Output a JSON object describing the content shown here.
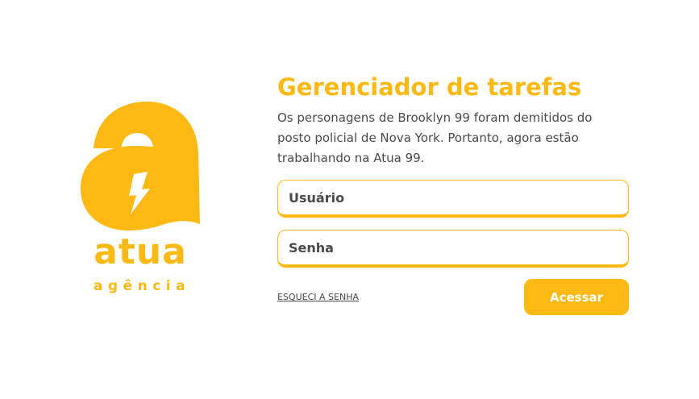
{
  "colors": {
    "brand_yellow": "#fdb913",
    "text_dark": "#4a4a4a",
    "background": "#ffffff"
  },
  "logo": {
    "mark_icon": "atua-a-lightning-logo-icon",
    "word": "atua",
    "sub": "agência"
  },
  "login": {
    "title": "Gerenciador de tarefas",
    "description": "Os personagens de Brooklyn 99 foram demitidos do posto policial de Nova York. Portanto, agora estão trabalhando na Atua 99.",
    "username": {
      "placeholder": "Usuário",
      "value": ""
    },
    "password": {
      "placeholder": "Senha",
      "value": ""
    },
    "forgot_label": "ESQUECI A SENHA",
    "submit_label": "Acessar"
  }
}
